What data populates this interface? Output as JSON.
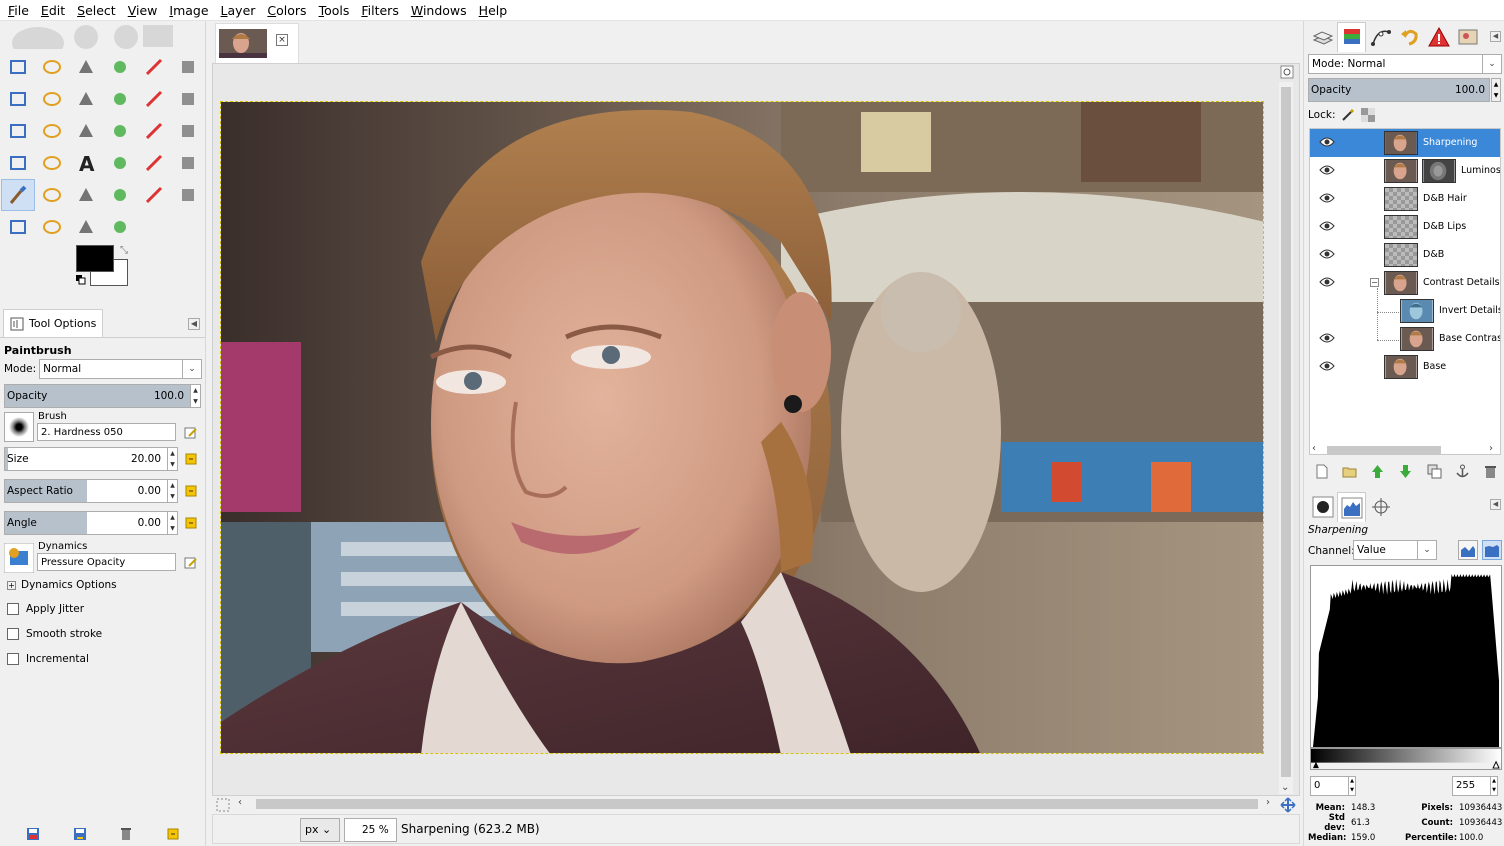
{
  "menubar": {
    "items": [
      "File",
      "Edit",
      "Select",
      "View",
      "Image",
      "Layer",
      "Colors",
      "Tools",
      "Filters",
      "Windows",
      "Help"
    ]
  },
  "toolbox": {
    "tools": [
      "rect-select-icon",
      "ellipse-select-icon",
      "free-select-icon",
      "fuzzy-select-icon",
      "color-select-icon",
      "scissors-icon",
      "foreground-select-icon",
      "paths-icon",
      "color-picker-icon",
      "zoom-icon",
      "measure-icon",
      "move-icon",
      "align-icon",
      "crop-icon",
      "rotate-icon",
      "scale-icon",
      "shear-icon",
      "perspective-icon",
      "flip-icon",
      "cage-icon",
      "text-icon",
      "bucket-fill-icon",
      "blend-icon",
      "pencil-icon",
      "paintbrush-icon",
      "eraser-icon",
      "airbrush-icon",
      "ink-icon",
      "clone-icon",
      "heal-icon",
      "perspective-clone-icon",
      "blur-icon",
      "smudge-icon",
      "dodge-icon"
    ],
    "active_tool": "paintbrush-icon"
  },
  "tool_options": {
    "tab_label": "Tool Options",
    "tool_name": "Paintbrush",
    "mode_label": "Mode:",
    "mode_value": "Normal",
    "opacity_label": "Opacity",
    "opacity_value": "100.0",
    "brush_label": "Brush",
    "brush_value": "2. Hardness 050",
    "size_label": "Size",
    "size_value": "20.00",
    "aspect_label": "Aspect Ratio",
    "aspect_value": "0.00",
    "angle_label": "Angle",
    "angle_value": "0.00",
    "dynamics_label": "Dynamics",
    "dynamics_value": "Pressure Opacity",
    "dynamics_options_label": "Dynamics Options",
    "apply_jitter_label": "Apply Jitter",
    "smooth_stroke_label": "Smooth stroke",
    "incremental_label": "Incremental"
  },
  "canvas": {
    "unit": "px",
    "zoom": "25 %",
    "status": "Sharpening (623.2 MB)"
  },
  "layers_panel": {
    "mode_label": "Mode: Normal",
    "opacity_label": "Opacity",
    "opacity_value": "100.0",
    "lock_label": "Lock:",
    "layers": [
      {
        "name": "Sharpening",
        "selected": true,
        "visible": true,
        "indent": 0
      },
      {
        "name": "Luminos",
        "selected": false,
        "visible": true,
        "indent": 0
      },
      {
        "name": "D&B Hair",
        "selected": false,
        "visible": true,
        "indent": 0
      },
      {
        "name": "D&B Lips",
        "selected": false,
        "visible": true,
        "indent": 0
      },
      {
        "name": "D&B",
        "selected": false,
        "visible": true,
        "indent": 0
      },
      {
        "name": "Contrast Details",
        "selected": false,
        "visible": true,
        "indent": 0
      },
      {
        "name": "Invert Details",
        "selected": false,
        "visible": false,
        "indent": 1
      },
      {
        "name": "Base Contrast",
        "selected": false,
        "visible": true,
        "indent": 1
      },
      {
        "name": "Base",
        "selected": false,
        "visible": true,
        "indent": 0
      }
    ]
  },
  "histogram": {
    "layer_name": "Sharpening",
    "channel_label": "Channel:",
    "channel_value": "Value",
    "range_min": "0",
    "range_max": "255",
    "mean_label": "Mean:",
    "mean_value": "148.3",
    "stddev_label": "Std dev:",
    "stddev_value": "61.3",
    "median_label": "Median:",
    "median_value": "159.0",
    "pixels_label": "Pixels:",
    "pixels_value": "10936443",
    "count_label": "Count:",
    "count_value": "10936443",
    "percentile_label": "Percentile:",
    "percentile_value": "100.0"
  },
  "colors": {
    "selection": "#3b88d9",
    "slider_fill": "#b6c1cc",
    "foreground": "#000000",
    "background": "#ffffff"
  }
}
